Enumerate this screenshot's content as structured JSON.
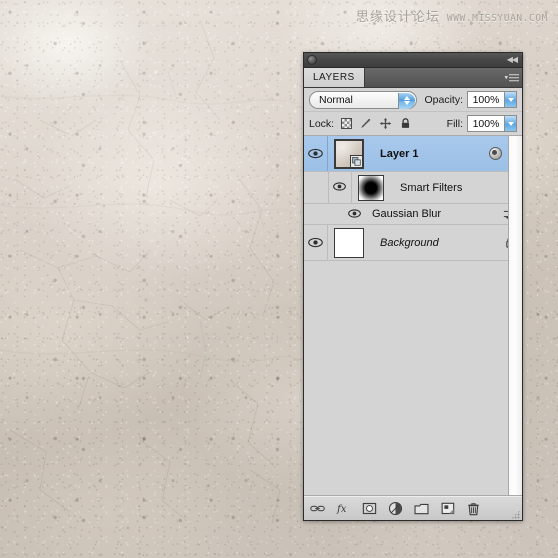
{
  "watermark": {
    "site_cn": "思缘设计论坛",
    "site_url": "WWW.MISSYUAN.COM"
  },
  "panel": {
    "titlebar": {
      "grip_icon": "circle-grip-icon",
      "collapse_icon": "double-left-arrow-icon",
      "collapse_glyph": "◀◀"
    },
    "tab": {
      "label": "LAYERS",
      "menu_icon": "panel-menu-icon"
    },
    "blend": {
      "mode_value": "Normal",
      "stepper_icon": "up-down-stepper-icon",
      "opacity_label": "Opacity:",
      "opacity_value": "100%",
      "opacity_arrow_icon": "chevron-down-icon"
    },
    "lock": {
      "label": "Lock:",
      "icons": [
        {
          "name": "lock-transparency-icon",
          "title": "Lock transparent pixels"
        },
        {
          "name": "lock-image-brush-icon",
          "title": "Lock image pixels"
        },
        {
          "name": "lock-position-move-icon",
          "title": "Lock position"
        },
        {
          "name": "lock-all-padlock-icon",
          "title": "Lock all"
        }
      ],
      "fill_label": "Fill:",
      "fill_value": "100%",
      "fill_arrow_icon": "chevron-down-icon"
    },
    "layers": [
      {
        "name": "Layer 1",
        "style": "bold",
        "selected": true,
        "visible": true,
        "visibility_icon": "eye-icon",
        "thumbnail": "smart-object-texture-thumbnail",
        "badge_icon": "smart-object-badge-icon",
        "right_icons": [
          {
            "name": "smart-filter-indicator-icon"
          },
          {
            "name": "collapse-triangle-icon"
          }
        ]
      },
      {
        "name": "Smart Filters",
        "style": "plain",
        "selected": false,
        "visible": true,
        "visibility_icon": "eye-icon",
        "thumbnail": "smart-filter-mask-thumbnail",
        "indent": 1
      },
      {
        "name": "Gaussian Blur",
        "style": "plain",
        "selected": false,
        "visible": true,
        "visibility_icon": "eye-icon",
        "indent": 2,
        "right_icons": [
          {
            "name": "filter-settings-sliders-icon"
          }
        ]
      },
      {
        "name": "Background",
        "style": "italic",
        "selected": false,
        "visible": true,
        "visibility_icon": "eye-icon",
        "thumbnail": "white-thumbnail",
        "right_icons": [
          {
            "name": "lock-padlock-icon"
          }
        ]
      }
    ],
    "footer_buttons": [
      {
        "name": "link-layers-icon",
        "label": "Link layers"
      },
      {
        "name": "add-layer-style-fx-icon",
        "label": "fx"
      },
      {
        "name": "add-layer-mask-icon",
        "label": "Add layer mask"
      },
      {
        "name": "new-adjustment-layer-icon",
        "label": "New adjustment layer"
      },
      {
        "name": "new-group-folder-icon",
        "label": "New group"
      },
      {
        "name": "new-layer-icon",
        "label": "New layer"
      },
      {
        "name": "delete-layer-trash-icon",
        "label": "Delete layer"
      }
    ],
    "resize_grip_icon": "resize-grip-icon"
  },
  "colors": {
    "panel_bg": "#d4d4d4",
    "titlebar": "#474747",
    "tabstrip": "#5c5c5c",
    "tab_bg": "#d4d4d4",
    "selection_blue": "#9fc3e8",
    "aqua_stepper": "#4e9bdc",
    "canvas_texture": "#d8d0c7",
    "watermark_text": "#a9a29a"
  }
}
